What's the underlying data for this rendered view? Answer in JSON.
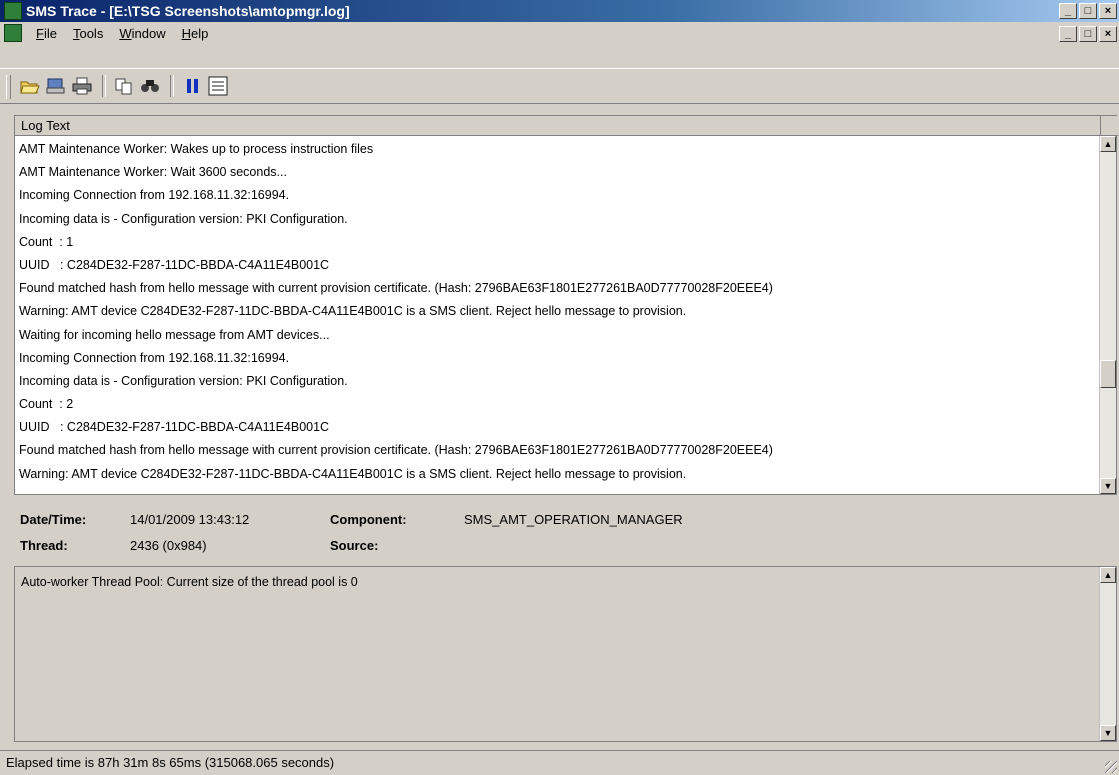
{
  "window": {
    "title": "SMS Trace - [E:\\TSG Screenshots\\amtopmgr.log]",
    "buttons": {
      "minimize": "_",
      "restore": "□",
      "close": "×"
    }
  },
  "menu": {
    "items": [
      {
        "accel": "F",
        "rest": "ile"
      },
      {
        "accel": "T",
        "rest": "ools"
      },
      {
        "accel": "W",
        "rest": "indow"
      },
      {
        "accel": "H",
        "rest": "elp"
      }
    ]
  },
  "toolbar": {
    "icons": [
      "open-icon",
      "print-preview-icon",
      "print-icon",
      "copy-icon",
      "find-icon",
      "pause-icon",
      "highlight-icon"
    ]
  },
  "log": {
    "column_header": "Log Text",
    "rows": [
      "AMT Maintenance Worker: Wakes up to process instruction files",
      "AMT Maintenance Worker: Wait 3600 seconds...",
      "Incoming Connection from 192.168.11.32:16994.",
      "Incoming data is - Configuration version: PKI Configuration.",
      "Count  : 1",
      "UUID   : C284DE32-F287-11DC-BBDA-C4A11E4B001C",
      "Found matched hash from hello message with current provision certificate. (Hash: 2796BAE63F1801E277261BA0D77770028F20EEE4)",
      "Warning: AMT device C284DE32-F287-11DC-BBDA-C4A11E4B001C is a SMS client. Reject hello message to provision.",
      "Waiting for incoming hello message from AMT devices...",
      "Incoming Connection from 192.168.11.32:16994.",
      "Incoming data is - Configuration version: PKI Configuration.",
      "Count  : 2",
      "UUID   : C284DE32-F287-11DC-BBDA-C4A11E4B001C",
      "Found matched hash from hello message with current provision certificate. (Hash: 2796BAE63F1801E277261BA0D77770028F20EEE4)",
      "Warning: AMT device C284DE32-F287-11DC-BBDA-C4A11E4B001C is a SMS client. Reject hello message to provision."
    ]
  },
  "details": {
    "datetime_label": "Date/Time:",
    "datetime_value": "14/01/2009 13:43:12",
    "component_label": "Component:",
    "component_value": "SMS_AMT_OPERATION_MANAGER",
    "thread_label": "Thread:",
    "thread_value": "2436 (0x984)",
    "source_label": "Source:",
    "source_value": ""
  },
  "message": {
    "text": "Auto-worker Thread Pool: Current size of the thread pool is 0"
  },
  "status": {
    "text": "Elapsed time is 87h 31m 8s 65ms (315068.065 seconds)"
  }
}
